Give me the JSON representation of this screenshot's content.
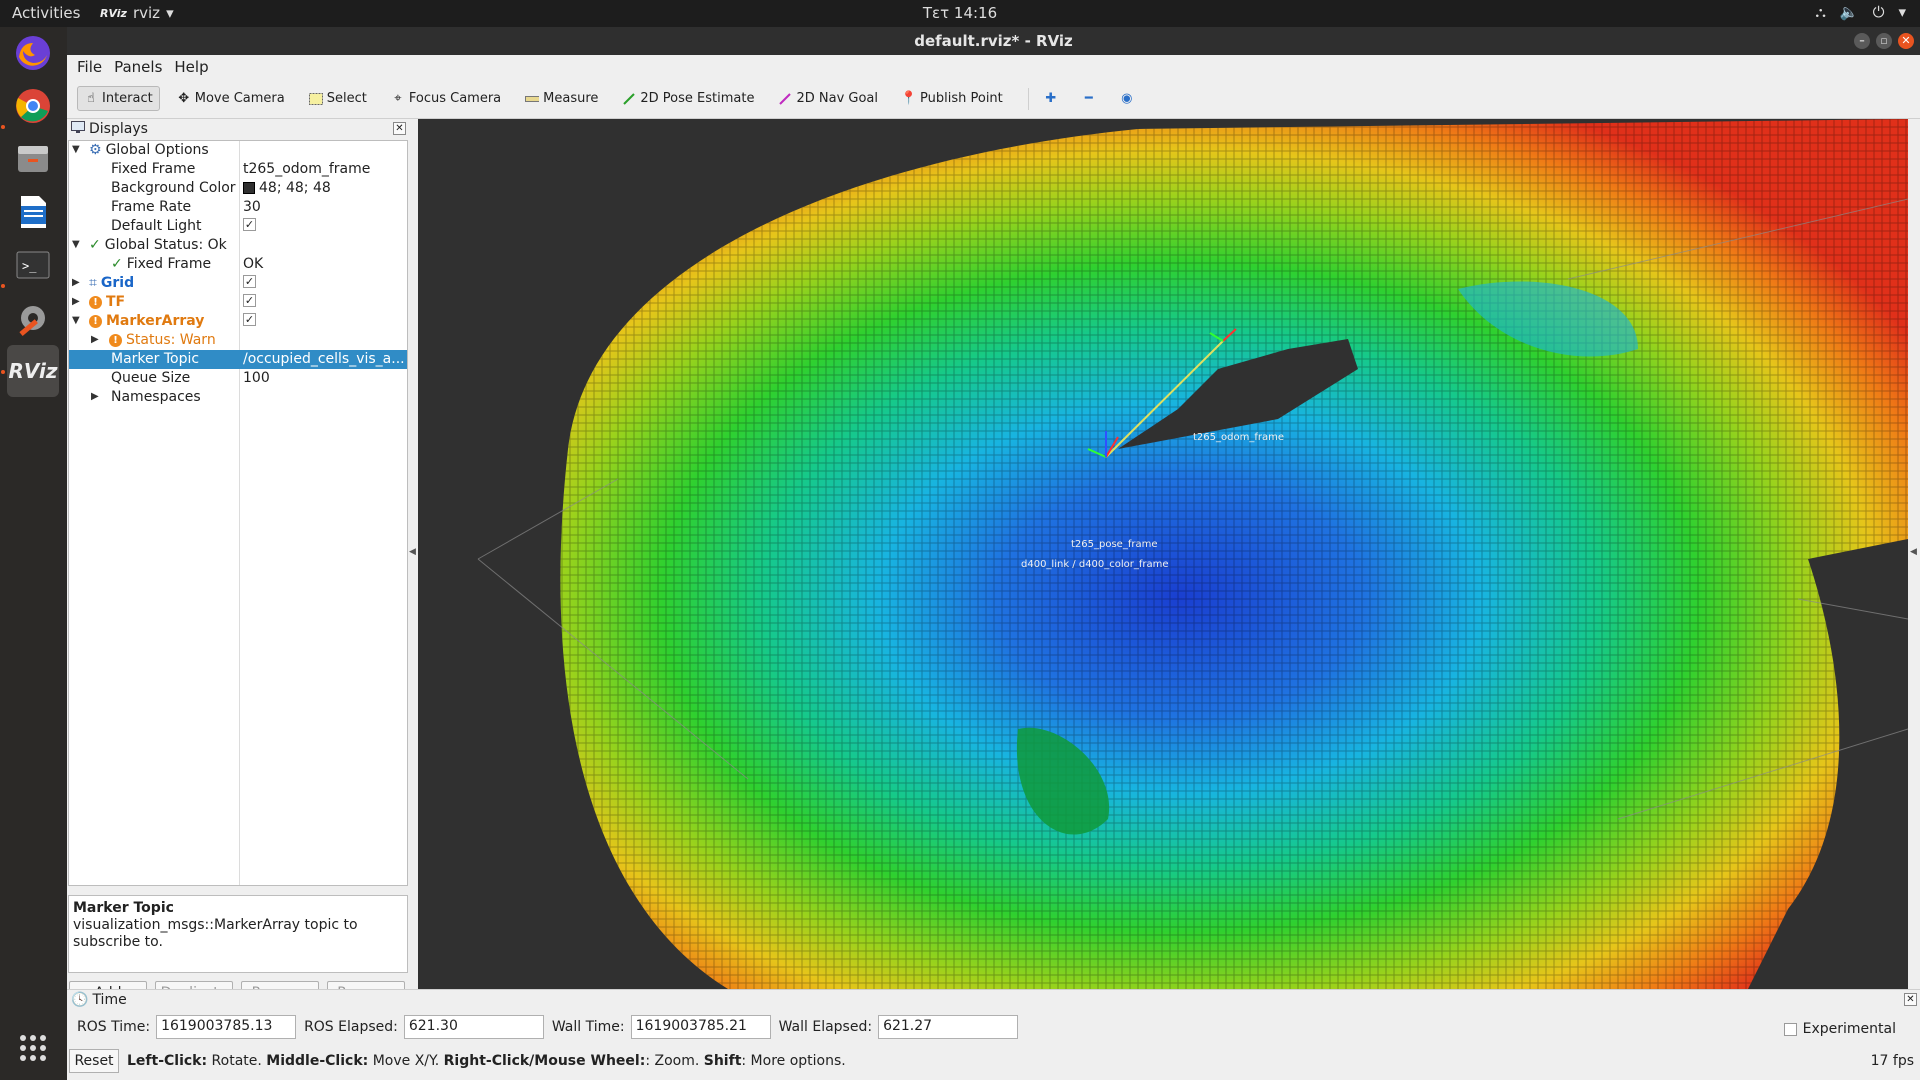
{
  "topbar": {
    "activities": "Activities",
    "app_icon": "RViz",
    "app_name": "rviz",
    "clock": "Τετ 14:16"
  },
  "window": {
    "title": "default.rviz* - RViz"
  },
  "menu": [
    "File",
    "Panels",
    "Help"
  ],
  "toolbar": {
    "interact": "Interact",
    "move_camera": "Move Camera",
    "select": "Select",
    "focus_camera": "Focus Camera",
    "measure": "Measure",
    "pose_estimate": "2D Pose Estimate",
    "nav_goal": "2D Nav Goal",
    "publish_point": "Publish Point"
  },
  "displays": {
    "title": "Displays",
    "global_options": "Global Options",
    "fixed_frame_label": "Fixed Frame",
    "fixed_frame_value": "t265_odom_frame",
    "bg_color_label": "Background Color",
    "bg_color_value": "48; 48; 48",
    "bg_color_swatch": "#303030",
    "frame_rate_label": "Frame Rate",
    "frame_rate_value": "30",
    "default_light_label": "Default Light",
    "global_status": "Global Status: Ok",
    "status_fixed_frame": "Fixed Frame",
    "status_fixed_frame_value": "OK",
    "grid": "Grid",
    "tf": "TF",
    "marker_array": "MarkerArray",
    "status_warn": "Status: Warn",
    "marker_topic_label": "Marker Topic",
    "marker_topic_value": "/occupied_cells_vis_a...",
    "queue_size_label": "Queue Size",
    "queue_size_value": "100",
    "namespaces": "Namespaces"
  },
  "description": {
    "title": "Marker Topic",
    "text": "visualization_msgs::MarkerArray topic to subscribe to."
  },
  "buttons": {
    "add": "Add",
    "duplicate": "Duplicate",
    "remove": "Remove",
    "rename": "Rename"
  },
  "view": {
    "frame_label_1": "t265_odom_frame",
    "frame_label_2": "t265_pose_frame",
    "frame_label_3": "d400_link / d400_color_frame"
  },
  "time": {
    "title": "Time",
    "ros_time_label": "ROS Time:",
    "ros_time": "1619003785.13",
    "ros_elapsed_label": "ROS Elapsed:",
    "ros_elapsed": "621.30",
    "wall_time_label": "Wall Time:",
    "wall_time": "1619003785.21",
    "wall_elapsed_label": "Wall Elapsed:",
    "wall_elapsed": "621.27",
    "experimental": "Experimental",
    "reset": "Reset",
    "hint_left_b": "Left-Click:",
    "hint_left": " Rotate. ",
    "hint_middle_b": "Middle-Click:",
    "hint_middle": " Move X/Y. ",
    "hint_right_b": "Right-Click/Mouse Wheel:",
    "hint_right": ": Zoom. ",
    "hint_shift_b": "Shift",
    "hint_shift": ": More options.",
    "fps": "17 fps"
  }
}
